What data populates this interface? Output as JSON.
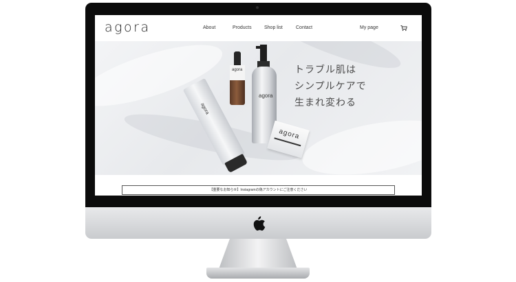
{
  "site": {
    "logo": "agora",
    "nav": [
      "About",
      "Products",
      "Shop list",
      "Contact"
    ],
    "my_page": "My page",
    "cart_icon": "cart-icon"
  },
  "hero": {
    "copy": [
      "トラブル肌は",
      "シンプルケアで",
      "生まれ変わる"
    ],
    "product_labels": {
      "tube": "agora",
      "dropper": "agora",
      "pump": "agora",
      "box": "agora"
    }
  },
  "notice": {
    "text": "【重要なお知らせ】Instagramの偽アカウントにご注意ください"
  },
  "colors": {
    "bezel": "#0b0b0b",
    "chin": "#d8d9db",
    "text": "#333333"
  }
}
